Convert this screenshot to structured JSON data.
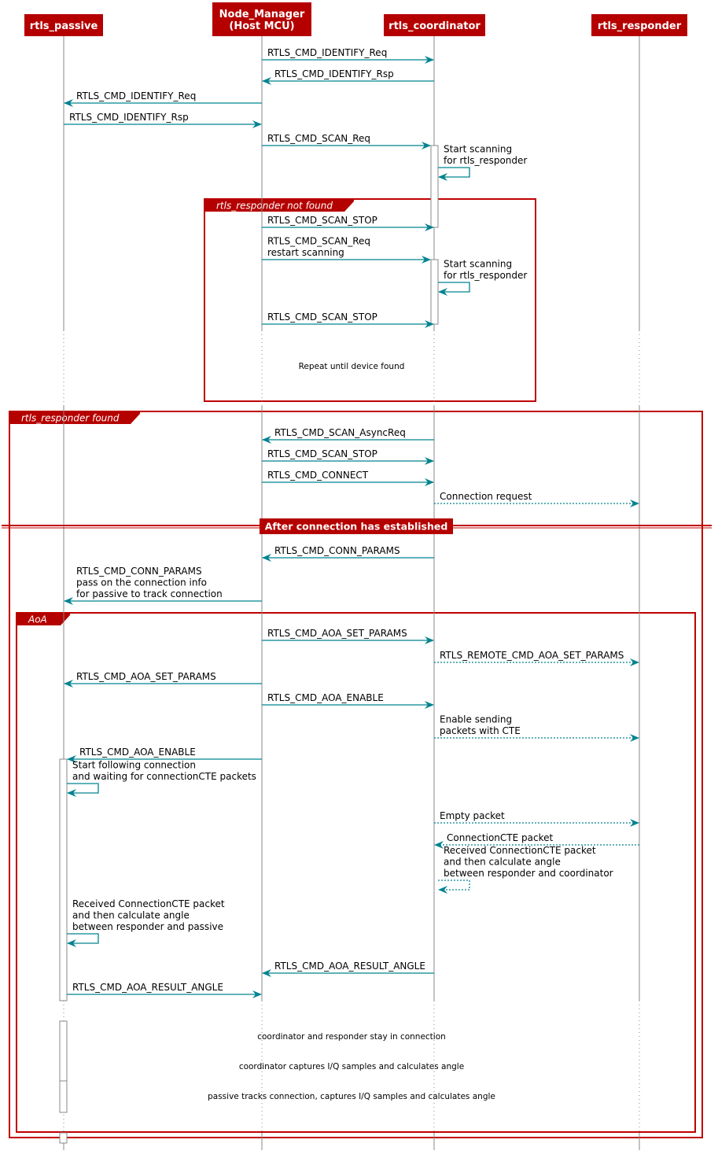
{
  "colors": {
    "header_bg": "#b50000",
    "arrow": "#00838f",
    "lifeline": "#888888",
    "frame": "#c00000",
    "text": "#000000"
  },
  "participants": [
    {
      "id": "passive",
      "label": [
        "rtls_passive"
      ]
    },
    {
      "id": "node",
      "label": [
        "Node_Manager",
        "(Host MCU)"
      ]
    },
    {
      "id": "coord",
      "label": [
        "rtls_coordinator"
      ]
    },
    {
      "id": "resp",
      "label": [
        "rtls_responder"
      ]
    }
  ],
  "messages": [
    {
      "from": "node",
      "to": "coord",
      "lines": [
        "RTLS_CMD_IDENTIFY_Req"
      ],
      "style": "solid"
    },
    {
      "from": "coord",
      "to": "node",
      "lines": [
        "RTLS_CMD_IDENTIFY_Rsp"
      ],
      "style": "solid"
    },
    {
      "from": "node",
      "to": "passive",
      "lines": [
        "RTLS_CMD_IDENTIFY_Req"
      ],
      "style": "solid"
    },
    {
      "from": "passive",
      "to": "node",
      "lines": [
        "RTLS_CMD_IDENTIFY_Rsp"
      ],
      "style": "solid"
    },
    {
      "from": "node",
      "to": "coord",
      "lines": [
        "RTLS_CMD_SCAN_Req"
      ],
      "style": "solid"
    },
    {
      "from": "coord",
      "to": "coord",
      "lines": [
        "Start scanning",
        "for rtls_responder"
      ],
      "style": "solid"
    },
    {
      "from": "node",
      "to": "coord",
      "lines": [
        "RTLS_CMD_SCAN_STOP"
      ],
      "style": "solid"
    },
    {
      "from": "node",
      "to": "coord",
      "lines": [
        "RTLS_CMD_SCAN_Req",
        "restart scanning"
      ],
      "style": "solid"
    },
    {
      "from": "coord",
      "to": "coord",
      "lines": [
        "Start scanning",
        "for rtls_responder"
      ],
      "style": "solid"
    },
    {
      "from": "node",
      "to": "coord",
      "lines": [
        "RTLS_CMD_SCAN_STOP"
      ],
      "style": "solid"
    },
    {
      "from": "coord",
      "to": "node",
      "lines": [
        "RTLS_CMD_SCAN_AsyncReq"
      ],
      "style": "solid"
    },
    {
      "from": "node",
      "to": "coord",
      "lines": [
        "RTLS_CMD_SCAN_STOP"
      ],
      "style": "solid"
    },
    {
      "from": "node",
      "to": "coord",
      "lines": [
        "RTLS_CMD_CONNECT"
      ],
      "style": "solid"
    },
    {
      "from": "coord",
      "to": "resp",
      "lines": [
        "Connection request"
      ],
      "style": "dotted"
    },
    {
      "from": "coord",
      "to": "node",
      "lines": [
        "RTLS_CMD_CONN_PARAMS"
      ],
      "style": "solid"
    },
    {
      "from": "node",
      "to": "passive",
      "lines": [
        "RTLS_CMD_CONN_PARAMS",
        "pass on the connection info",
        "for passive to track connection"
      ],
      "style": "solid"
    },
    {
      "from": "node",
      "to": "coord",
      "lines": [
        "RTLS_CMD_AOA_SET_PARAMS"
      ],
      "style": "solid"
    },
    {
      "from": "coord",
      "to": "resp",
      "lines": [
        "RTLS_REMOTE_CMD_AOA_SET_PARAMS"
      ],
      "style": "dotted"
    },
    {
      "from": "node",
      "to": "passive",
      "lines": [
        "RTLS_CMD_AOA_SET_PARAMS"
      ],
      "style": "solid"
    },
    {
      "from": "node",
      "to": "coord",
      "lines": [
        "RTLS_CMD_AOA_ENABLE"
      ],
      "style": "solid"
    },
    {
      "from": "coord",
      "to": "resp",
      "lines": [
        "Enable sending",
        "packets with CTE"
      ],
      "style": "dotted"
    },
    {
      "from": "node",
      "to": "passive",
      "lines": [
        "RTLS_CMD_AOA_ENABLE"
      ],
      "style": "solid"
    },
    {
      "from": "passive",
      "to": "passive",
      "lines": [
        "Start following connection",
        "and waiting for connectionCTE packets"
      ],
      "style": "solid"
    },
    {
      "from": "coord",
      "to": "resp",
      "lines": [
        "Empty packet"
      ],
      "style": "dotted"
    },
    {
      "from": "resp",
      "to": "coord",
      "lines": [
        "ConnectionCTE packet"
      ],
      "style": "dotted"
    },
    {
      "from": "coord",
      "to": "coord",
      "lines": [
        "Received ConnectionCTE packet",
        "and then calculate angle",
        "between responder and coordinator"
      ],
      "style": "dotted"
    },
    {
      "from": "passive",
      "to": "passive",
      "lines": [
        "Received ConnectionCTE packet",
        "and then calculate angle",
        "between responder and passive"
      ],
      "style": "solid"
    },
    {
      "from": "coord",
      "to": "node",
      "lines": [
        "RTLS_CMD_AOA_RESULT_ANGLE"
      ],
      "style": "solid"
    },
    {
      "from": "passive",
      "to": "node",
      "lines": [
        "RTLS_CMD_AOA_RESULT_ANGLE"
      ],
      "style": "solid"
    }
  ],
  "groups": [
    {
      "title": "rtls_responder not found"
    },
    {
      "title": "rtls_responder found"
    },
    {
      "title": "AoA"
    }
  ],
  "separator": {
    "label": "After connection has established"
  },
  "delays": [
    {
      "text": "Repeat until device found"
    },
    {
      "text": "coordinator and responder stay in connection"
    },
    {
      "text": "coordinator captures I/Q samples and calculates angle"
    },
    {
      "text": "passive tracks connection, captures I/Q samples and calculates angle"
    }
  ]
}
